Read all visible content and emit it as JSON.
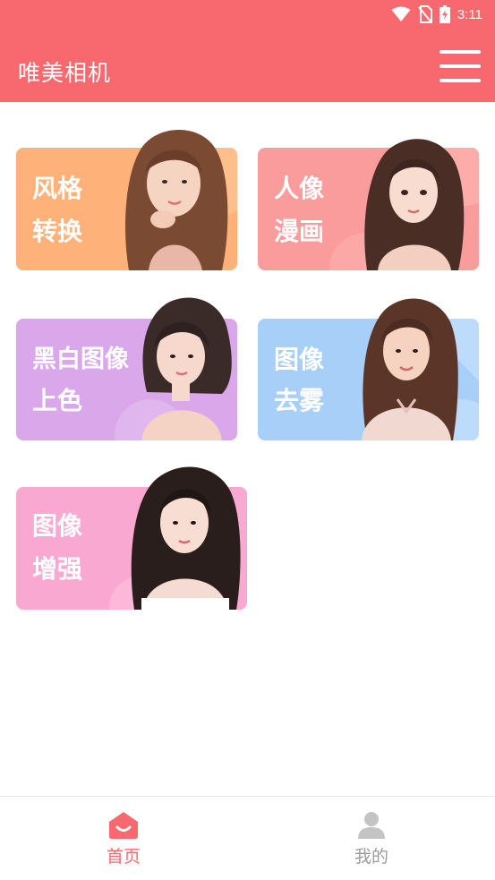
{
  "status": {
    "time": "3:11",
    "icons": [
      "wifi-icon",
      "no-sim-icon",
      "battery-charging-icon"
    ]
  },
  "app": {
    "title": "唯美相机",
    "menu_icon": "hamburger-menu-icon",
    "accent": "#f8686f"
  },
  "features": [
    {
      "line1": "风格",
      "line2": "转换",
      "color": "#ffb17a"
    },
    {
      "line1": "人像",
      "line2": "漫画",
      "color": "#fb9c9c"
    },
    {
      "line1": "黑白图像",
      "line2": "上色",
      "color": "#d9a7ea"
    },
    {
      "line1": "图像",
      "line2": "去雾",
      "color": "#a8cff8"
    },
    {
      "line1": "图像",
      "line2": "增强",
      "color": "#f9a9d1"
    }
  ],
  "tabs": [
    {
      "label": "首页",
      "icon": "home-icon",
      "active": true,
      "color": "#f8686f"
    },
    {
      "label": "我的",
      "icon": "user-icon",
      "active": false,
      "color": "#9b9b9b"
    }
  ]
}
